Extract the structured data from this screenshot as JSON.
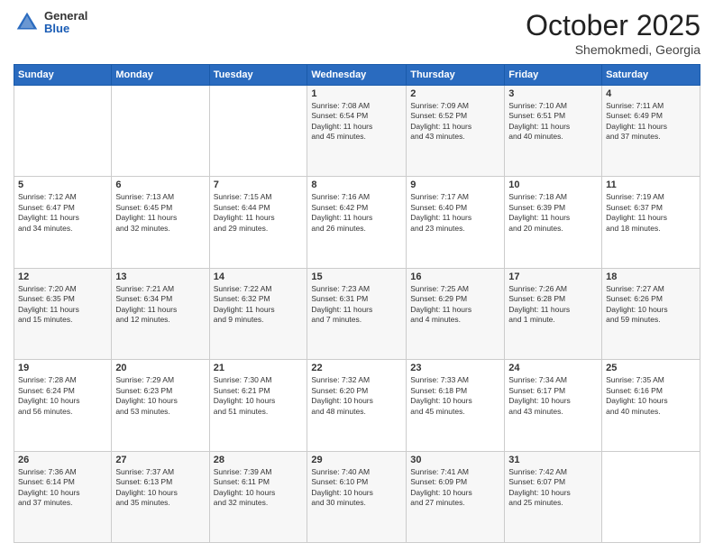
{
  "header": {
    "logo": {
      "general": "General",
      "blue": "Blue"
    },
    "month": "October 2025",
    "location": "Shemokmedi, Georgia"
  },
  "weekdays": [
    "Sunday",
    "Monday",
    "Tuesday",
    "Wednesday",
    "Thursday",
    "Friday",
    "Saturday"
  ],
  "weeks": [
    [
      {
        "day": "",
        "content": ""
      },
      {
        "day": "",
        "content": ""
      },
      {
        "day": "",
        "content": ""
      },
      {
        "day": "1",
        "content": "Sunrise: 7:08 AM\nSunset: 6:54 PM\nDaylight: 11 hours\nand 45 minutes."
      },
      {
        "day": "2",
        "content": "Sunrise: 7:09 AM\nSunset: 6:52 PM\nDaylight: 11 hours\nand 43 minutes."
      },
      {
        "day": "3",
        "content": "Sunrise: 7:10 AM\nSunset: 6:51 PM\nDaylight: 11 hours\nand 40 minutes."
      },
      {
        "day": "4",
        "content": "Sunrise: 7:11 AM\nSunset: 6:49 PM\nDaylight: 11 hours\nand 37 minutes."
      }
    ],
    [
      {
        "day": "5",
        "content": "Sunrise: 7:12 AM\nSunset: 6:47 PM\nDaylight: 11 hours\nand 34 minutes."
      },
      {
        "day": "6",
        "content": "Sunrise: 7:13 AM\nSunset: 6:45 PM\nDaylight: 11 hours\nand 32 minutes."
      },
      {
        "day": "7",
        "content": "Sunrise: 7:15 AM\nSunset: 6:44 PM\nDaylight: 11 hours\nand 29 minutes."
      },
      {
        "day": "8",
        "content": "Sunrise: 7:16 AM\nSunset: 6:42 PM\nDaylight: 11 hours\nand 26 minutes."
      },
      {
        "day": "9",
        "content": "Sunrise: 7:17 AM\nSunset: 6:40 PM\nDaylight: 11 hours\nand 23 minutes."
      },
      {
        "day": "10",
        "content": "Sunrise: 7:18 AM\nSunset: 6:39 PM\nDaylight: 11 hours\nand 20 minutes."
      },
      {
        "day": "11",
        "content": "Sunrise: 7:19 AM\nSunset: 6:37 PM\nDaylight: 11 hours\nand 18 minutes."
      }
    ],
    [
      {
        "day": "12",
        "content": "Sunrise: 7:20 AM\nSunset: 6:35 PM\nDaylight: 11 hours\nand 15 minutes."
      },
      {
        "day": "13",
        "content": "Sunrise: 7:21 AM\nSunset: 6:34 PM\nDaylight: 11 hours\nand 12 minutes."
      },
      {
        "day": "14",
        "content": "Sunrise: 7:22 AM\nSunset: 6:32 PM\nDaylight: 11 hours\nand 9 minutes."
      },
      {
        "day": "15",
        "content": "Sunrise: 7:23 AM\nSunset: 6:31 PM\nDaylight: 11 hours\nand 7 minutes."
      },
      {
        "day": "16",
        "content": "Sunrise: 7:25 AM\nSunset: 6:29 PM\nDaylight: 11 hours\nand 4 minutes."
      },
      {
        "day": "17",
        "content": "Sunrise: 7:26 AM\nSunset: 6:28 PM\nDaylight: 11 hours\nand 1 minute."
      },
      {
        "day": "18",
        "content": "Sunrise: 7:27 AM\nSunset: 6:26 PM\nDaylight: 10 hours\nand 59 minutes."
      }
    ],
    [
      {
        "day": "19",
        "content": "Sunrise: 7:28 AM\nSunset: 6:24 PM\nDaylight: 10 hours\nand 56 minutes."
      },
      {
        "day": "20",
        "content": "Sunrise: 7:29 AM\nSunset: 6:23 PM\nDaylight: 10 hours\nand 53 minutes."
      },
      {
        "day": "21",
        "content": "Sunrise: 7:30 AM\nSunset: 6:21 PM\nDaylight: 10 hours\nand 51 minutes."
      },
      {
        "day": "22",
        "content": "Sunrise: 7:32 AM\nSunset: 6:20 PM\nDaylight: 10 hours\nand 48 minutes."
      },
      {
        "day": "23",
        "content": "Sunrise: 7:33 AM\nSunset: 6:18 PM\nDaylight: 10 hours\nand 45 minutes."
      },
      {
        "day": "24",
        "content": "Sunrise: 7:34 AM\nSunset: 6:17 PM\nDaylight: 10 hours\nand 43 minutes."
      },
      {
        "day": "25",
        "content": "Sunrise: 7:35 AM\nSunset: 6:16 PM\nDaylight: 10 hours\nand 40 minutes."
      }
    ],
    [
      {
        "day": "26",
        "content": "Sunrise: 7:36 AM\nSunset: 6:14 PM\nDaylight: 10 hours\nand 37 minutes."
      },
      {
        "day": "27",
        "content": "Sunrise: 7:37 AM\nSunset: 6:13 PM\nDaylight: 10 hours\nand 35 minutes."
      },
      {
        "day": "28",
        "content": "Sunrise: 7:39 AM\nSunset: 6:11 PM\nDaylight: 10 hours\nand 32 minutes."
      },
      {
        "day": "29",
        "content": "Sunrise: 7:40 AM\nSunset: 6:10 PM\nDaylight: 10 hours\nand 30 minutes."
      },
      {
        "day": "30",
        "content": "Sunrise: 7:41 AM\nSunset: 6:09 PM\nDaylight: 10 hours\nand 27 minutes."
      },
      {
        "day": "31",
        "content": "Sunrise: 7:42 AM\nSunset: 6:07 PM\nDaylight: 10 hours\nand 25 minutes."
      },
      {
        "day": "",
        "content": ""
      }
    ]
  ]
}
